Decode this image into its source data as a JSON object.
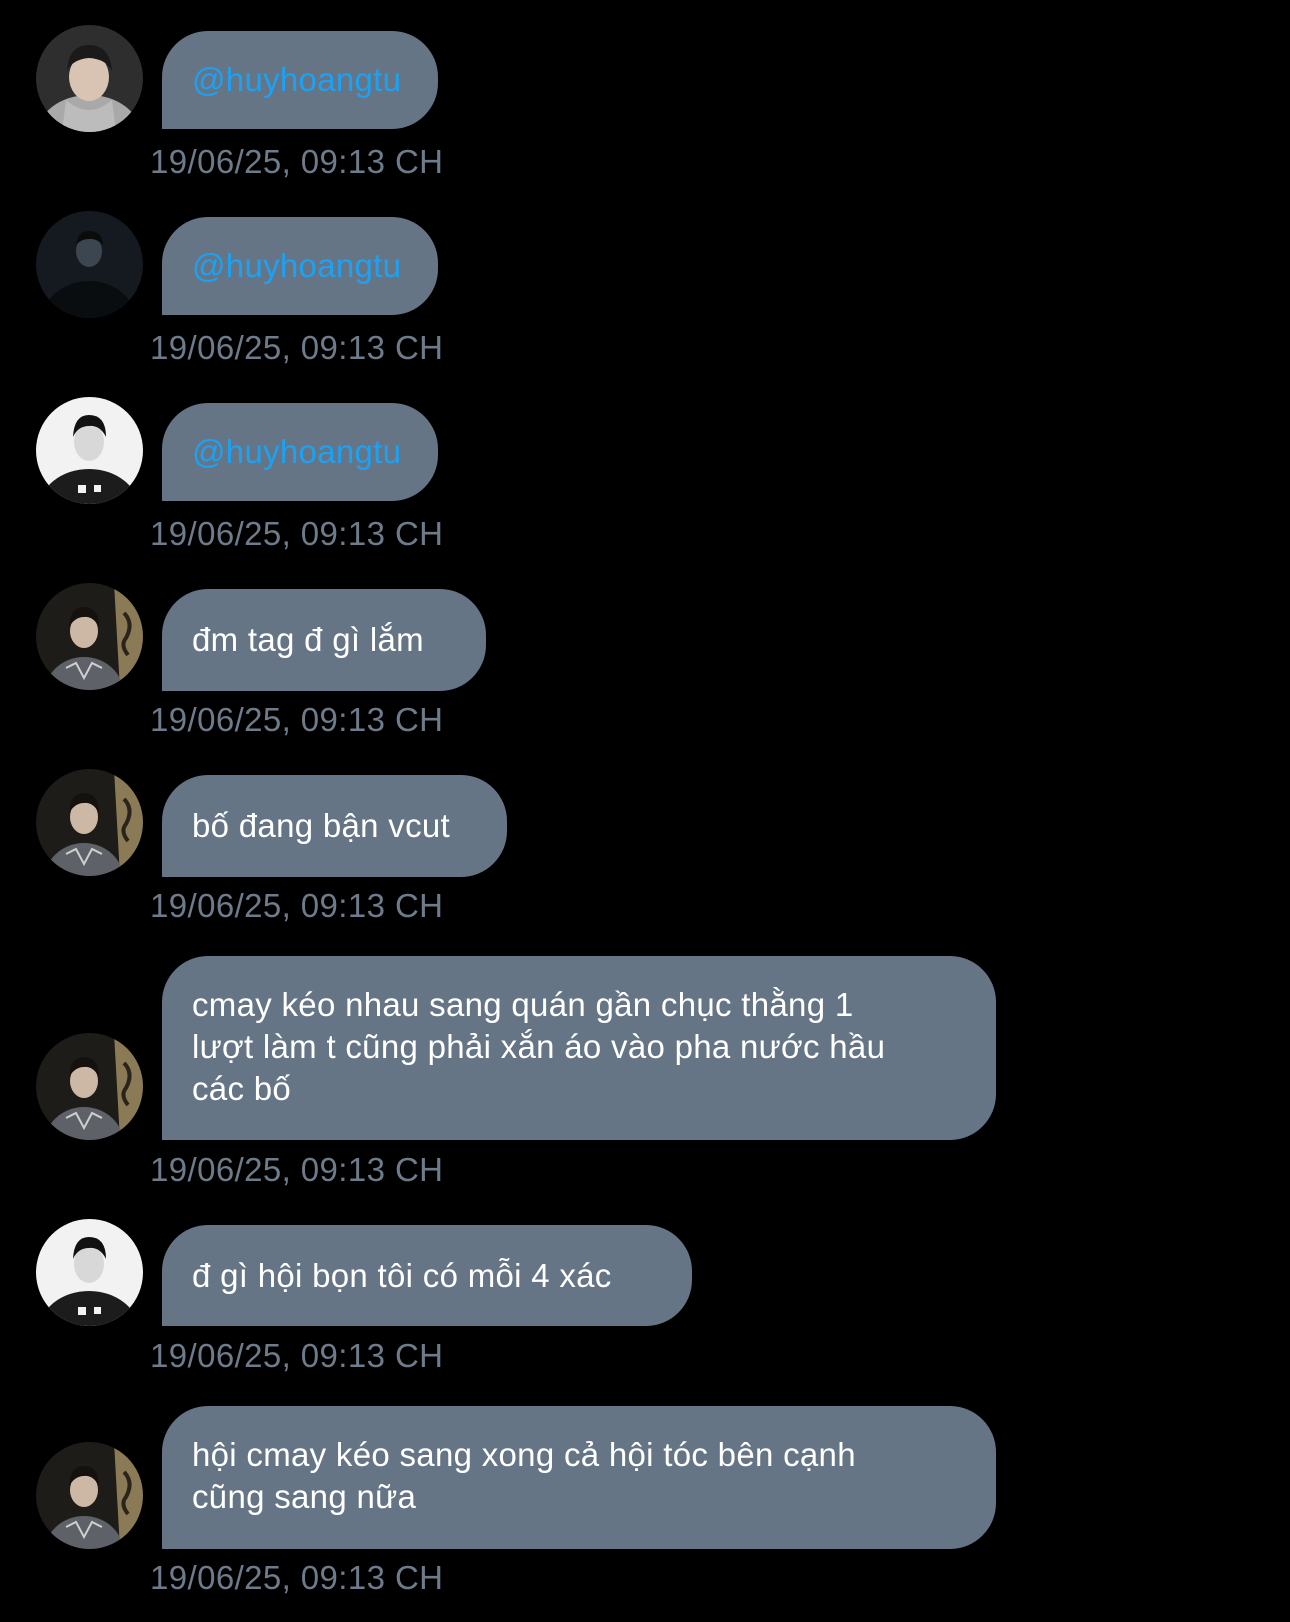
{
  "theme": {
    "background": "#000000",
    "bubble": "#667585",
    "mention": "#1da1f2",
    "timestamp": "#6e7b8a"
  },
  "messages": [
    {
      "avatar": "avatar-hoodie-boy-icon",
      "text": "@huyhoangtu",
      "mention": true,
      "time": "19/06/25, 09:13 CH"
    },
    {
      "avatar": "avatar-dark-portrait-icon",
      "text": "@huyhoangtu",
      "mention": true,
      "time": "19/06/25, 09:13 CH"
    },
    {
      "avatar": "avatar-bw-jersey-icon",
      "text": "@huyhoangtu",
      "mention": true,
      "time": "19/06/25, 09:13 CH"
    },
    {
      "avatar": "avatar-gray-jersey-icon",
      "text": "đm tag đ gì lắm",
      "mention": false,
      "time": "19/06/25, 09:13 CH"
    },
    {
      "avatar": "avatar-gray-jersey-icon",
      "text": "bố đang bận vcut",
      "mention": false,
      "time": "19/06/25, 09:13 CH"
    },
    {
      "avatar": "avatar-gray-jersey-icon",
      "text": "cmay kéo nhau sang quán gần chục thằng 1\nlượt làm t cũng phải xắn áo vào pha nước hầu\ncác bố",
      "mention": false,
      "time": "19/06/25, 09:13 CH"
    },
    {
      "avatar": "avatar-bw-jersey-icon",
      "text": "đ gì hội bọn tôi có mỗi 4 xác",
      "mention": false,
      "time": "19/06/25, 09:13 CH"
    },
    {
      "avatar": "avatar-gray-jersey-icon",
      "text": "hội cmay kéo sang xong cả hội tóc bên cạnh\ncũng sang nữa",
      "mention": false,
      "time": "19/06/25, 09:13 CH"
    }
  ]
}
